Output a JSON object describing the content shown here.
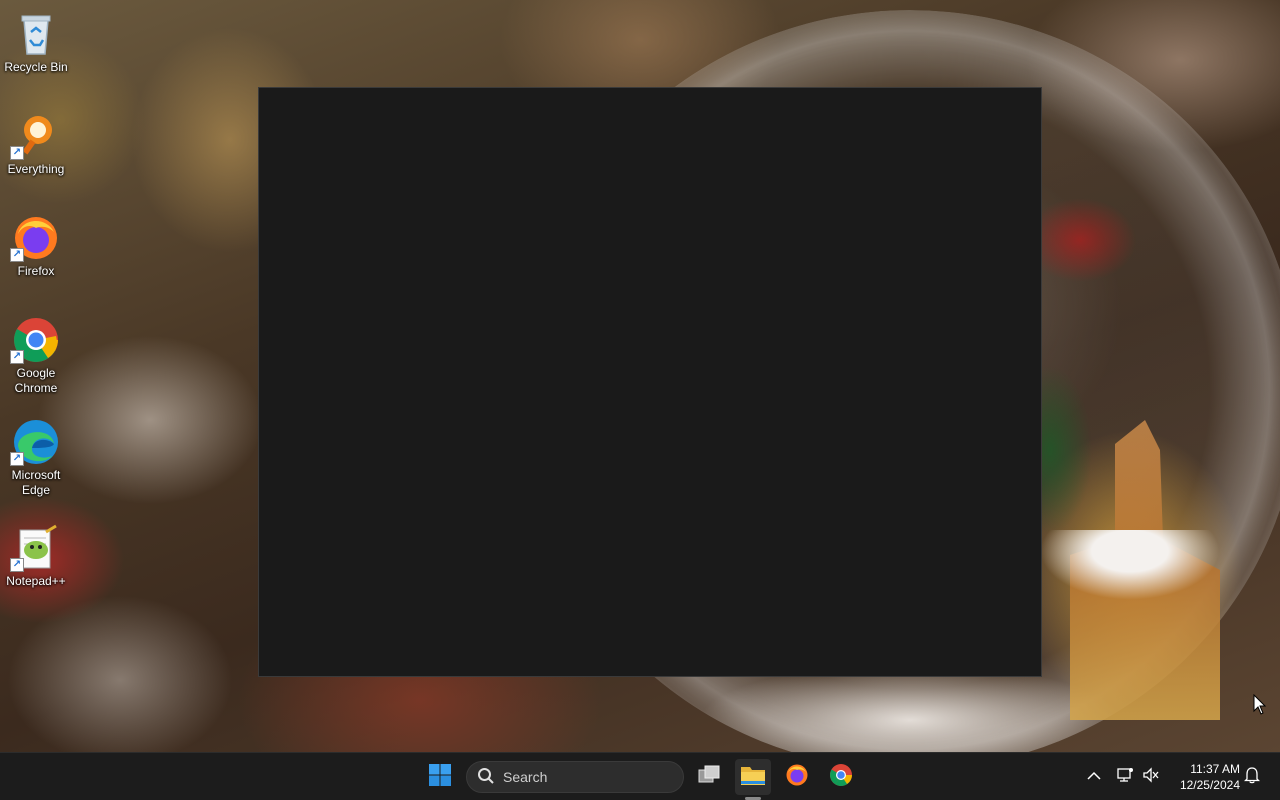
{
  "desktop": {
    "icons": [
      {
        "label": "Recycle Bin",
        "icon": "recycle-bin-icon"
      },
      {
        "label": "Everything",
        "icon": "everything-icon"
      },
      {
        "label": "Firefox",
        "icon": "firefox-icon"
      },
      {
        "label": "Google Chrome",
        "icon": "chrome-icon"
      },
      {
        "label": "Microsoft Edge",
        "icon": "edge-icon"
      },
      {
        "label": "Notepad++",
        "icon": "notepadpp-icon"
      }
    ]
  },
  "window": {
    "background": "#1a1a1a"
  },
  "taskbar": {
    "search_label": "Search",
    "pinned": [
      "start-icon",
      "task-view-icon",
      "file-explorer-icon",
      "firefox-icon",
      "chrome-icon"
    ],
    "tray": [
      "chevron-up-icon",
      "network-icon",
      "volume-muted-icon",
      "notifications-icon"
    ],
    "time": "11:37 AM",
    "date": "12/25/2024"
  },
  "colors": {
    "taskbar": "#1c1c1c",
    "accent": "#0078d4"
  }
}
